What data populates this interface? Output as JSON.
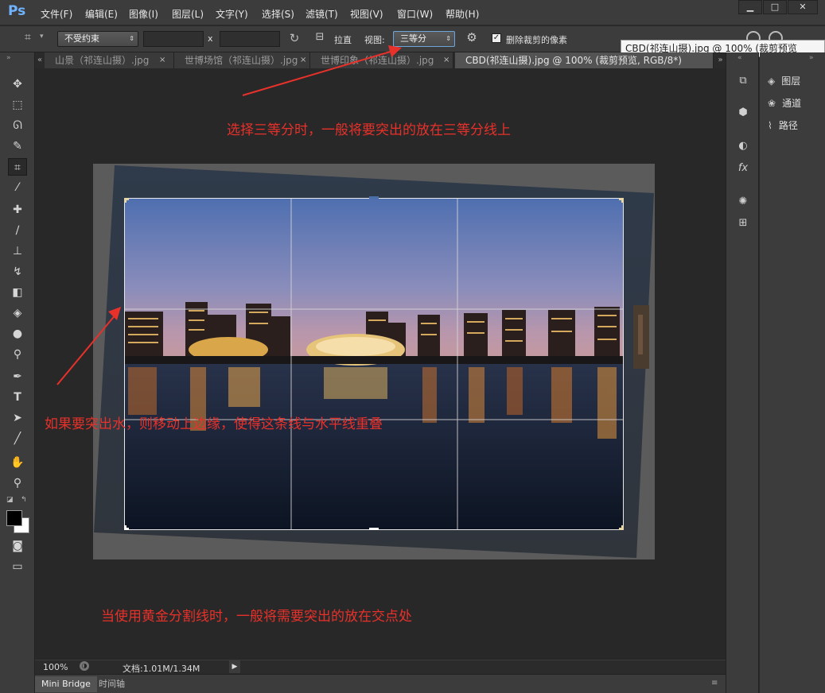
{
  "app": {
    "logo": "Ps"
  },
  "menu": [
    "文件(F)",
    "编辑(E)",
    "图像(I)",
    "图层(L)",
    "文字(Y)",
    "选择(S)",
    "滤镜(T)",
    "视图(V)",
    "窗口(W)",
    "帮助(H)"
  ],
  "window_controls": {
    "minimize": "▁",
    "maximize": "□",
    "close": "✕"
  },
  "options": {
    "constraint": "不受约束",
    "width_value": "",
    "height_value": "",
    "times": "x",
    "straighten_label": "拉直",
    "view_label": "视图:",
    "view_value": "三等分",
    "delete_pixels_label": "删除裁剪的像素",
    "delete_pixels_checked": true
  },
  "tooltip": "CBD(祁连山摄).jpg @ 100% (裁剪预览",
  "tabs": [
    {
      "label": "山景（祁连山摄）.jpg"
    },
    {
      "label": "世博场馆（祁连山摄）.jpg"
    },
    {
      "label": "世博印象（祁连山摄）.jpg"
    },
    {
      "label": "CBD(祁连山摄).jpg @ 100% (裁剪预览, RGB/8*)",
      "active": true
    }
  ],
  "status": {
    "zoom": "100%",
    "doc": "文档:1.01M/1.34M"
  },
  "bottom_tabs": [
    "Mini Bridge",
    "时间轴"
  ],
  "panels": [
    "图层",
    "通道",
    "路径"
  ],
  "annotations": {
    "top": "选择三等分时，一般将要突出的放在三等分线上",
    "middle": "如果要突出水，则移动上边缘，使得这条线与水平线重叠",
    "bottom": "当使用黄金分割线时，一般将需要突出的放在交点处"
  },
  "colors": {
    "annotation": "#e8312a",
    "ui_bg": "#3c3c3c",
    "canvas_bg": "#282828"
  }
}
